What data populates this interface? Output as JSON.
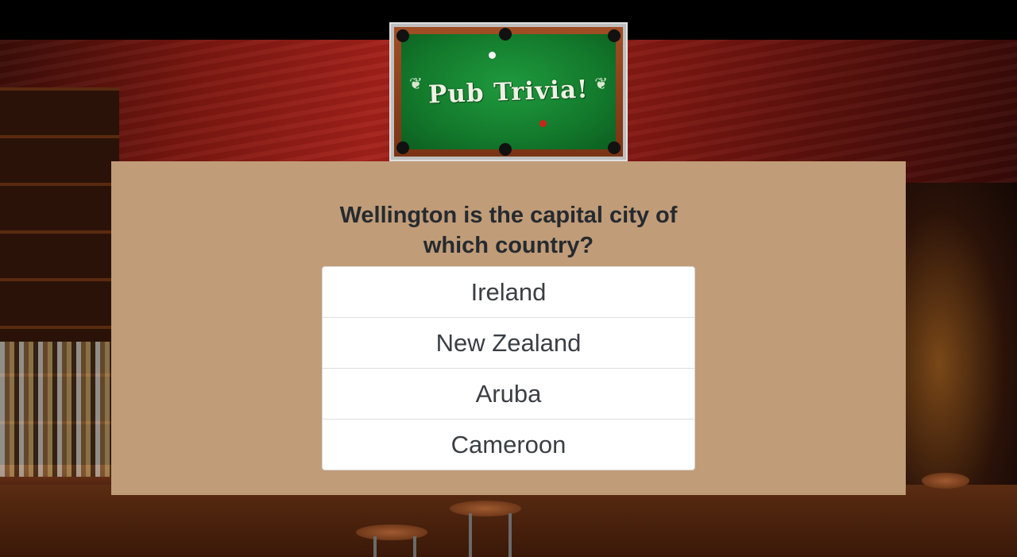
{
  "logo": {
    "text": "Pub Trivia!"
  },
  "quiz": {
    "question": "Wellington is the capital city of which country?",
    "answers": [
      {
        "label": "Ireland"
      },
      {
        "label": "New Zealand"
      },
      {
        "label": "Aruba"
      },
      {
        "label": "Cameroon"
      }
    ]
  },
  "colors": {
    "panel": "#c09c78",
    "top_bar": "#000000",
    "felt": "#137a2c",
    "question_text": "#252a2f"
  }
}
